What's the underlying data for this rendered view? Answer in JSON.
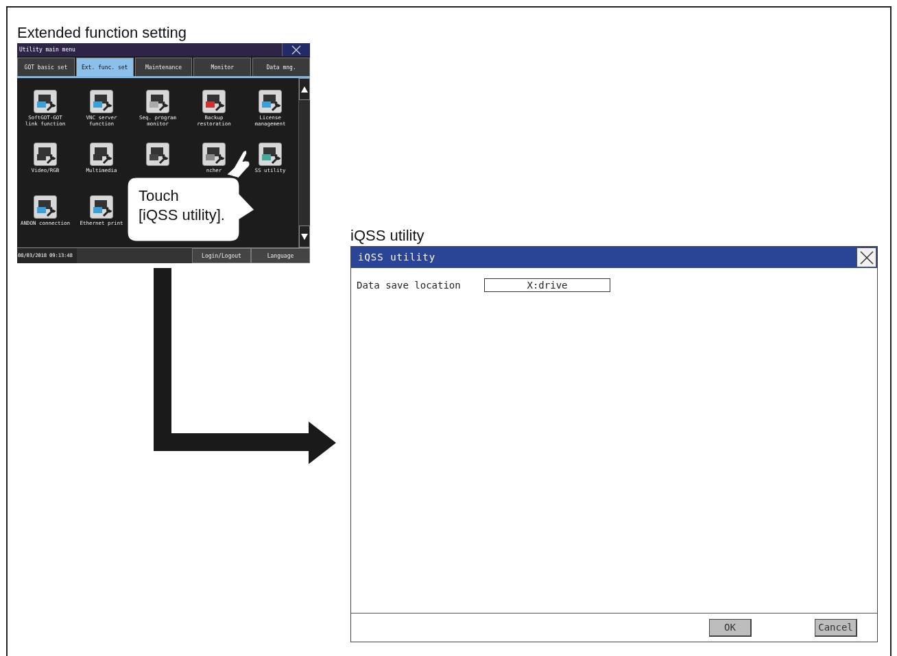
{
  "left_caption": "Extended function setting",
  "utility_menu": {
    "title": "Utility main menu",
    "tabs": [
      {
        "label": "GOT basic set",
        "selected": false
      },
      {
        "label": "Ext. func. set",
        "selected": true
      },
      {
        "label": "Maintenance",
        "selected": false
      },
      {
        "label": "Monitor",
        "selected": false
      },
      {
        "label": "Data mng.",
        "selected": false
      }
    ],
    "icons": [
      {
        "label": "SoftGOT-GOT\nlink function"
      },
      {
        "label": "VNC server\nfunction"
      },
      {
        "label": "Seq. program\nmonitor"
      },
      {
        "label": "Backup\nrestoration"
      },
      {
        "label": "License\nmanagement"
      },
      {
        "label": "Video/RGB"
      },
      {
        "label": "Multimedia"
      },
      {
        "under_callout": true
      },
      {
        "label": "ncher"
      },
      {
        "label": "SS utility"
      },
      {
        "label": "ANDON connection"
      },
      {
        "label": "Ethernet print"
      }
    ],
    "status_bar": {
      "datetime": "08/03/2018 09:13:48",
      "buttons": [
        "Login/Logout",
        "Language"
      ]
    }
  },
  "callout": {
    "text": "Touch\n[iQSS utility]."
  },
  "right_caption": "iQSS utility",
  "iqss_window": {
    "title": "iQSS utility",
    "fields": [
      {
        "label": "Data save location",
        "value": "X:drive"
      }
    ],
    "buttons": [
      "OK",
      "Cancel"
    ]
  }
}
